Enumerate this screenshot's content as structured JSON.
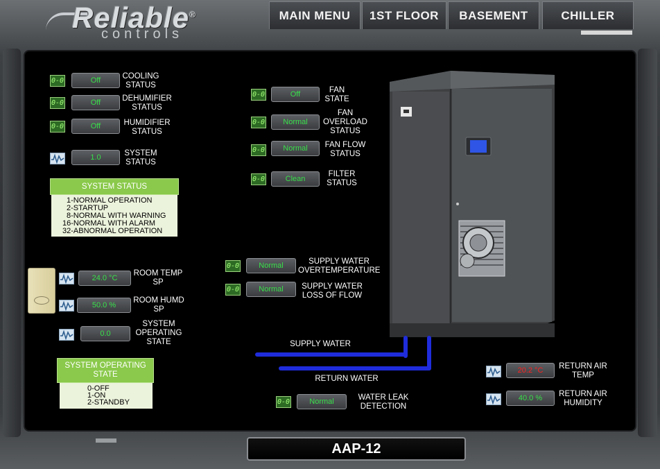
{
  "logo": {
    "main": "Reliable",
    "sub": "controls",
    "registered": "®"
  },
  "nav": {
    "main_menu": "MAIN MENU",
    "first_floor": "1ST FLOOR",
    "basement": "BASEMENT",
    "chiller": "CHILLER"
  },
  "indicator_icons": {
    "digital": "0-0",
    "analog": "waveform-icon"
  },
  "status": {
    "cooling": {
      "value": "Off",
      "label": "COOLING\nSTATUS"
    },
    "dehumidifier": {
      "value": "Off",
      "label": "DEHUMIFIER\nSTATUS"
    },
    "humidifier": {
      "value": "Off",
      "label": "HUMIDIFIER\nSTATUS"
    },
    "system": {
      "value": "1.0",
      "label": "SYSTEM\nSTATUS"
    }
  },
  "system_status_legend": {
    "title": "SYSTEM STATUS",
    "items": [
      "1-NORMAL OPERATION",
      "2-STARTUP",
      "8-NORMAL WITH WARNING",
      "16-NORMAL WITH ALARM",
      "32-ABNORMAL OPERATION"
    ]
  },
  "fan": {
    "state": {
      "value": "Off",
      "label": "FAN\nSTATE"
    },
    "overload": {
      "value": "Normal",
      "label": "FAN\nOVERLOAD\nSTATUS"
    },
    "flow": {
      "value": "Normal",
      "label": "FAN FLOW\nSTATUS"
    },
    "filter": {
      "value": "Clean",
      "label": "FILTER\nSTATUS"
    }
  },
  "supply_water": {
    "overtemp": {
      "value": "Normal",
      "label": "SUPPLY WATER\nOVERTEMPERATURE"
    },
    "loss_flow": {
      "value": "Normal",
      "label": "SUPPLY WATER\nLOSS OF FLOW"
    }
  },
  "room": {
    "temp_sp": {
      "value": "24.0 °C",
      "label": "ROOM TEMP\nSP"
    },
    "humd_sp": {
      "value": "50.0 %",
      "label": "ROOM HUMD\nSP"
    },
    "operating_state": {
      "value": "0.0",
      "label": "SYSTEM\nOPERATING\nSTATE"
    }
  },
  "operating_state_legend": {
    "title": "SYSTEM OPERATING\nSTATE",
    "items": [
      "0-OFF",
      "1-ON",
      "2-STANDBY"
    ]
  },
  "pipes": {
    "supply": "SUPPLY WATER",
    "return": "RETURN WATER"
  },
  "return_air": {
    "temp": {
      "value": "20.2 °C",
      "label": "RETURN AIR\nTEMP"
    },
    "humidity": {
      "value": "40.0 %",
      "label": "RETURN AIR\nHUMIDITY"
    }
  },
  "water_leak": {
    "value": "Normal",
    "label": "WATER LEAK\nDETECTION"
  },
  "footer": {
    "unit_name": "AAP-12"
  },
  "colors": {
    "value_green": "#39e04a",
    "value_red": "#ff2020",
    "legend_green": "#8ac94b",
    "pipe_blue": "#1f2cdc"
  }
}
